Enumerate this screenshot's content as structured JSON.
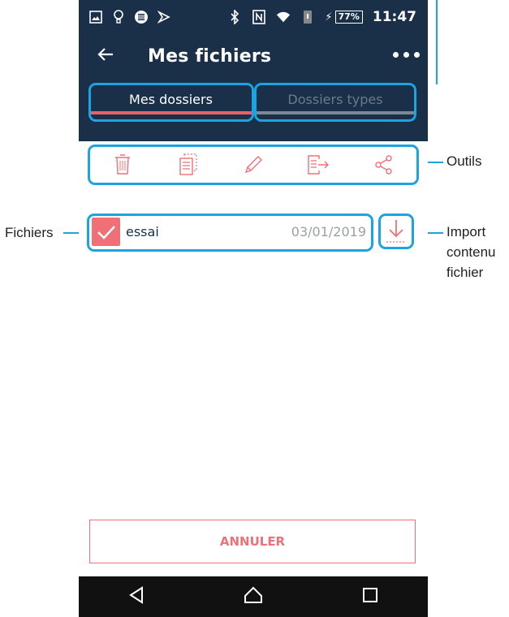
{
  "status_bar": {
    "battery_percent": "77%",
    "time": "11:47"
  },
  "app_bar": {
    "back_icon": "arrow-left-icon",
    "title": "Mes fichiers",
    "more_icon": "overflow-dots-icon"
  },
  "tabs": [
    {
      "label": "Mes dossiers",
      "active": true
    },
    {
      "label": "Dossiers types",
      "active": false
    }
  ],
  "toolbar": {
    "tools": [
      "trash-icon",
      "copy-icon",
      "pencil-icon",
      "export-icon",
      "share-icon"
    ]
  },
  "files": [
    {
      "name": "essai",
      "date": "03/01/2019",
      "checked": true
    }
  ],
  "import_button": {
    "icon": "download-arrow-icon"
  },
  "cancel_label": "ANNULER",
  "annotations": {
    "outils": "Outils",
    "fichiers": "Fichiers",
    "import_line1": "Import",
    "import_line2": "contenu",
    "import_line3": "fichier"
  },
  "colors": {
    "header": "#1a2f48",
    "accent": "#f07078",
    "highlight": "#1da3e0"
  }
}
